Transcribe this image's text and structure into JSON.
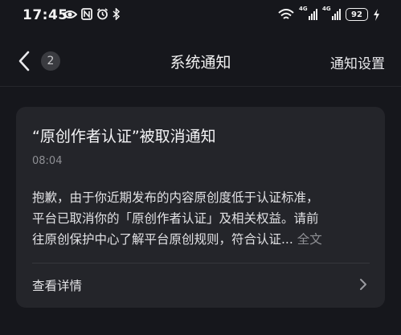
{
  "status_bar": {
    "time": "17:45",
    "network_1": "4G",
    "network_2": "4G",
    "battery": "92"
  },
  "nav": {
    "unread_count": "2",
    "title": "系统通知",
    "settings_label": "通知设置"
  },
  "notification": {
    "title": "“原创作者认证”被取消通知",
    "time": "08:04",
    "body_lines": [
      "抱歉，由于你近期发布的内容原创度低于认证标准，",
      "平台已取消你的「原创作者认证」及相关权益。请前",
      "往原创保护中心了解平台原创规则，符合认证..."
    ],
    "full_text_label": "全文",
    "details_label": "查看详情"
  }
}
